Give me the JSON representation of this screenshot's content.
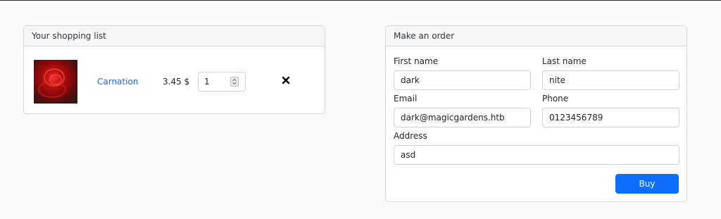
{
  "cart": {
    "title": "Your shopping list",
    "item": {
      "name": "Carnation",
      "price": "3.45 $",
      "quantity": "1",
      "image_subject": "red carnation flower photo",
      "remove_icon": "close-icon"
    }
  },
  "order": {
    "title": "Make an order",
    "first_name": {
      "label": "First name",
      "value": "dark"
    },
    "last_name": {
      "label": "Last name",
      "value": "nite"
    },
    "email": {
      "label": "Email",
      "value": "dark@magicgardens.htb"
    },
    "phone": {
      "label": "Phone",
      "value": "0123456789"
    },
    "address": {
      "label": "Address",
      "value": "asd"
    },
    "buy_label": "Buy"
  },
  "colors": {
    "accent": "#0d6efd",
    "page_background": "#f8f9fa",
    "card_header_background": "#f6f6f6"
  }
}
